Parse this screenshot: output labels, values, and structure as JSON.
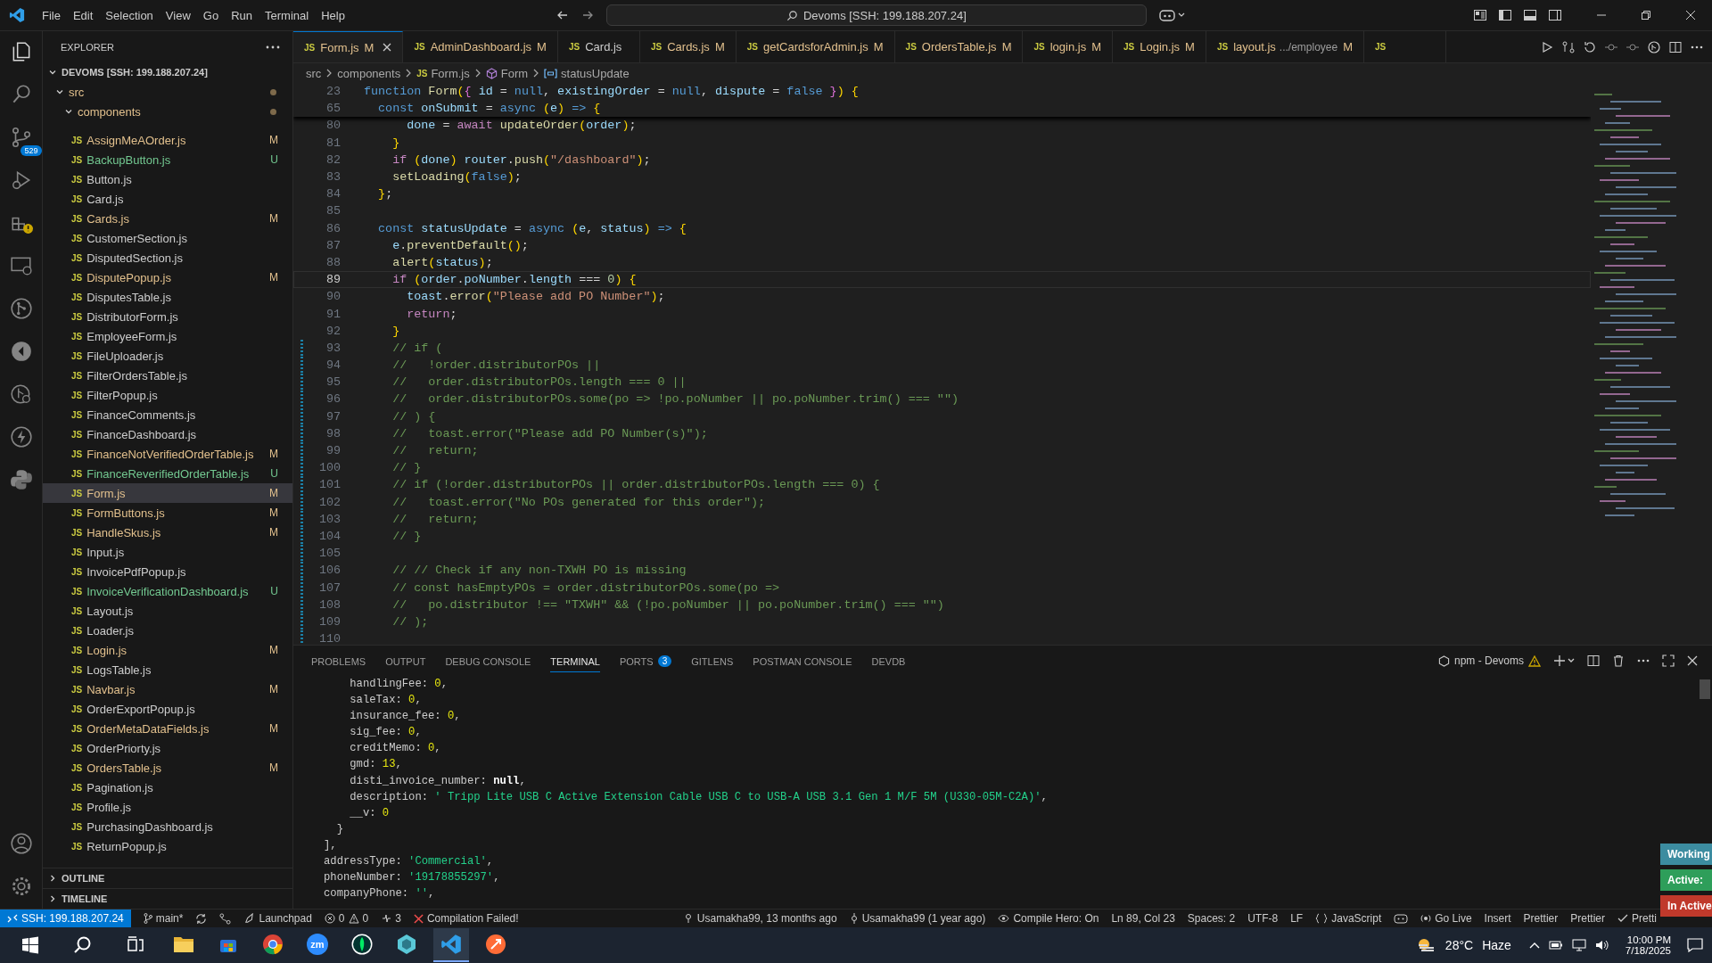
{
  "title_bar": {
    "menu": [
      "File",
      "Edit",
      "Selection",
      "View",
      "Go",
      "Run",
      "Terminal",
      "Help"
    ],
    "command_center": "Devoms [SSH: 199.188.207.24]"
  },
  "activity_bar": {
    "source_control_badge": "529"
  },
  "explorer": {
    "title": "EXPLORER",
    "root": {
      "name": "DEVOMS [SSH: 199.188.207.24]",
      "expanded": true
    },
    "folders": [
      {
        "name": "src",
        "expanded": true,
        "modified": true
      },
      {
        "name": "components",
        "expanded": true,
        "modified": true
      }
    ],
    "files": [
      {
        "icon": "JS",
        "name": "AssignMeAOrder.js",
        "status": "M",
        "selected": false
      },
      {
        "icon": "JS",
        "name": "BackupButton.js",
        "status": "U",
        "selected": false
      },
      {
        "icon": "JS",
        "name": "Button.js",
        "selected": false
      },
      {
        "icon": "JS",
        "name": "Card.js",
        "selected": false
      },
      {
        "icon": "JS",
        "name": "Cards.js",
        "status": "M",
        "selected": false
      },
      {
        "icon": "JS",
        "name": "CustomerSection.js",
        "selected": false
      },
      {
        "icon": "JS",
        "name": "DisputedSection.js",
        "selected": false
      },
      {
        "icon": "JS",
        "name": "DisputePopup.js",
        "status": "M",
        "selected": false
      },
      {
        "icon": "JS",
        "name": "DisputesTable.js",
        "selected": false
      },
      {
        "icon": "JS",
        "name": "DistributorForm.js",
        "selected": false
      },
      {
        "icon": "JS",
        "name": "EmployeeForm.js",
        "selected": false
      },
      {
        "icon": "JS",
        "name": "FileUploader.js",
        "selected": false
      },
      {
        "icon": "JS",
        "name": "FilterOrdersTable.js",
        "selected": false
      },
      {
        "icon": "JS",
        "name": "FilterPopup.js",
        "selected": false
      },
      {
        "icon": "JS",
        "name": "FinanceComments.js",
        "selected": false
      },
      {
        "icon": "JS",
        "name": "FinanceDashboard.js",
        "selected": false
      },
      {
        "icon": "JS",
        "name": "FinanceNotVerifiedOrderTable.js",
        "status": "M",
        "selected": false
      },
      {
        "icon": "JS",
        "name": "FinanceReverifiedOrderTable.js",
        "status": "U",
        "selected": false
      },
      {
        "icon": "JS",
        "name": "Form.js",
        "status": "M",
        "selected": true
      },
      {
        "icon": "JS",
        "name": "FormButtons.js",
        "status": "M",
        "selected": false
      },
      {
        "icon": "JS",
        "name": "HandleSkus.js",
        "status": "M",
        "selected": false
      },
      {
        "icon": "JS",
        "name": "Input.js",
        "selected": false
      },
      {
        "icon": "JS",
        "name": "InvoicePdfPopup.js",
        "selected": false
      },
      {
        "icon": "JS",
        "name": "InvoiceVerificationDashboard.js",
        "status": "U",
        "selected": false
      },
      {
        "icon": "JS",
        "name": "Layout.js",
        "selected": false
      },
      {
        "icon": "JS",
        "name": "Loader.js",
        "selected": false
      },
      {
        "icon": "JS",
        "name": "Login.js",
        "status": "M",
        "selected": false
      },
      {
        "icon": "JS",
        "name": "LogsTable.js",
        "selected": false
      },
      {
        "icon": "JS",
        "name": "Navbar.js",
        "status": "M",
        "selected": false
      },
      {
        "icon": "JS",
        "name": "OrderExportPopup.js",
        "selected": false
      },
      {
        "icon": "JS",
        "name": "OrderMetaDataFields.js",
        "status": "M",
        "selected": false
      },
      {
        "icon": "JS",
        "name": "OrderPriorty.js",
        "selected": false
      },
      {
        "icon": "JS",
        "name": "OrdersTable.js",
        "status": "M",
        "selected": false
      },
      {
        "icon": "JS",
        "name": "Pagination.js",
        "selected": false
      },
      {
        "icon": "JS",
        "name": "Profile.js",
        "selected": false
      },
      {
        "icon": "JS",
        "name": "PurchasingDashboard.js",
        "selected": false
      },
      {
        "icon": "JS",
        "name": "ReturnPopup.js",
        "selected": false
      }
    ],
    "sections": [
      {
        "name": "OUTLINE",
        "expanded": false
      },
      {
        "name": "TIMELINE",
        "expanded": false
      }
    ]
  },
  "tabs": [
    {
      "icon": "JS",
      "label": "Form.js",
      "status": "M",
      "selected": true
    },
    {
      "icon": "JS",
      "label": "AdminDashboard.js",
      "status": "M",
      "selected": false
    },
    {
      "icon": "JS",
      "label": "Card.js",
      "selected": false
    },
    {
      "icon": "JS",
      "label": "Cards.js",
      "status": "M",
      "selected": false
    },
    {
      "icon": "JS",
      "label": "getCardsforAdmin.js",
      "status": "M",
      "selected": false
    },
    {
      "icon": "JS",
      "label": "OrdersTable.js",
      "status": "M",
      "selected": false
    },
    {
      "icon": "JS",
      "label": "login.js",
      "status": "M",
      "selected": false
    },
    {
      "icon": "JS",
      "label": "Login.js",
      "status": "M",
      "selected": false
    },
    {
      "icon": "JS",
      "label": "layout.js",
      "description": ".../employee",
      "status": "M",
      "selected": false
    },
    {
      "icon": "JS",
      "selected": false
    }
  ],
  "breadcrumb": [
    {
      "kind": "folder",
      "label": "src"
    },
    {
      "kind": "folder",
      "label": "components"
    },
    {
      "kind": "file",
      "icon": "JS",
      "label": "Form.js"
    },
    {
      "kind": "function",
      "label": "Form"
    },
    {
      "kind": "variable",
      "label": "statusUpdate"
    }
  ],
  "editor": {
    "sticky_lines": [
      {
        "number": "23",
        "text": "function Form({ id = null, existingOrder = null, dispute = false }) {"
      },
      {
        "number": "65",
        "text": "  const onSubmit = async (e) => {"
      }
    ],
    "lines": [
      {
        "number": "80",
        "cursor": false,
        "changed": false,
        "text": "      done = await updateOrder(order);"
      },
      {
        "number": "81",
        "cursor": false,
        "changed": false,
        "text": "    }"
      },
      {
        "number": "82",
        "cursor": false,
        "changed": false,
        "text": "    if (done) router.push(\"/dashboard\");"
      },
      {
        "number": "83",
        "cursor": false,
        "changed": false,
        "text": "    setLoading(false);"
      },
      {
        "number": "84",
        "cursor": false,
        "changed": false,
        "text": "  };"
      },
      {
        "number": "85",
        "cursor": false,
        "changed": false
      },
      {
        "number": "86",
        "cursor": false,
        "changed": false,
        "text": "  const statusUpdate = async (e, status) => {"
      },
      {
        "number": "87",
        "cursor": false,
        "changed": false,
        "text": "    e.preventDefault();"
      },
      {
        "number": "88",
        "cursor": false,
        "changed": false,
        "text": "    alert(status);"
      },
      {
        "number": "89",
        "cursor": true,
        "changed": false,
        "text": "    if (order.poNumber.length === 0) {"
      },
      {
        "number": "90",
        "cursor": false,
        "changed": false,
        "text": "      toast.error(\"Please add PO Number\");"
      },
      {
        "number": "91",
        "cursor": false,
        "changed": false,
        "text": "      return;"
      },
      {
        "number": "92",
        "cursor": false,
        "changed": false,
        "text": "    }"
      },
      {
        "number": "93",
        "cursor": false,
        "changed": true,
        "text": "    // if ("
      },
      {
        "number": "94",
        "cursor": false,
        "changed": true,
        "text": "    //   !order.distributorPOs ||"
      },
      {
        "number": "95",
        "cursor": false,
        "changed": true,
        "text": "    //   order.distributorPOs.length === 0 ||"
      },
      {
        "number": "96",
        "cursor": false,
        "changed": true,
        "text": "    //   order.distributorPOs.some(po => !po.poNumber || po.poNumber.trim() === \"\")"
      },
      {
        "number": "97",
        "cursor": false,
        "changed": true,
        "text": "    // ) {"
      },
      {
        "number": "98",
        "cursor": false,
        "changed": true,
        "text": "    //   toast.error(\"Please add PO Number(s)\");"
      },
      {
        "number": "99",
        "cursor": false,
        "changed": true,
        "text": "    //   return;"
      },
      {
        "number": "100",
        "cursor": false,
        "changed": true,
        "text": "    // }"
      },
      {
        "number": "101",
        "cursor": false,
        "changed": true,
        "text": "    // if (!order.distributorPOs || order.distributorPOs.length === 0) {"
      },
      {
        "number": "102",
        "cursor": false,
        "changed": true,
        "text": "    //   toast.error(\"No POs generated for this order\");"
      },
      {
        "number": "103",
        "cursor": false,
        "changed": true,
        "text": "    //   return;"
      },
      {
        "number": "104",
        "cursor": false,
        "changed": true,
        "text": "    // }"
      },
      {
        "number": "105",
        "cursor": false,
        "changed": true
      },
      {
        "number": "106",
        "cursor": false,
        "changed": true,
        "text": "    // // Check if any non-TXWH PO is missing"
      },
      {
        "number": "107",
        "cursor": false,
        "changed": true,
        "text": "    // const hasEmptyPOs = order.distributorPOs.some(po =>"
      },
      {
        "number": "108",
        "cursor": false,
        "changed": true,
        "text": "    //   po.distributor !== \"TXWH\" && (!po.poNumber || po.poNumber.trim() === \"\")"
      },
      {
        "number": "109",
        "cursor": false,
        "changed": true,
        "text": "    // );"
      },
      {
        "number": "110",
        "cursor": false,
        "changed": true
      }
    ]
  },
  "panel": {
    "tabs": [
      {
        "label": "PROBLEMS",
        "selected": false
      },
      {
        "label": "OUTPUT",
        "selected": false
      },
      {
        "label": "DEBUG CONSOLE",
        "selected": false
      },
      {
        "label": "TERMINAL",
        "selected": true
      },
      {
        "label": "PORTS",
        "badge": "3",
        "selected": false
      },
      {
        "label": "GITLENS",
        "selected": false
      },
      {
        "label": "POSTMAN CONSOLE",
        "selected": false
      },
      {
        "label": "DEVDB",
        "selected": false
      }
    ],
    "terminal_name": "npm - Devoms",
    "terminal_lines": [
      "    handlingFee: 0,",
      "    saleTax: 0,",
      "    insurance_fee: 0,",
      "    sig_fee: 0,",
      "    creditMemo: 0,",
      "    gmd: 13,",
      "    disti_invoice_number: null,",
      "    description: ' Tripp Lite USB C Active Extension Cable USB C to USB-A USB 3.1 Gen 1 M/F 5M (U330-05M-C2A)',",
      "    __v: 0",
      "  }",
      "],",
      "addressType: 'Commercial',",
      "phoneNumber: '19178855297',",
      "companyPhone: '',"
    ]
  },
  "notifications": [
    {
      "label": "Working",
      "color": "#3c8ca0"
    },
    {
      "label": "Active:",
      "color": "#2e9e5a"
    },
    {
      "label": "In Active",
      "color": "#c0392b"
    }
  ],
  "status_bar": {
    "left": [
      {
        "kind": "remote",
        "text": "SSH: 199.188.207.24"
      },
      {
        "kind": "branch",
        "text": "main*"
      },
      {
        "kind": "sync"
      },
      {
        "kind": "flow"
      },
      {
        "kind": "launchpad",
        "text": "Launchpad"
      },
      {
        "kind": "problems",
        "errors": "0",
        "warnings": "0"
      },
      {
        "kind": "ports",
        "text": "3"
      },
      {
        "kind": "error",
        "text": "Compilation Failed!"
      }
    ],
    "right": [
      {
        "kind": "blame",
        "text": "Usamakha99, 13 months ago"
      },
      {
        "kind": "author",
        "text": "Usamakha99 (1 year ago)"
      },
      {
        "kind": "eye",
        "text": "Compile Hero: On"
      },
      {
        "kind": "text",
        "text": "Ln 89, Col 23"
      },
      {
        "kind": "text",
        "text": "Spaces: 2"
      },
      {
        "kind": "text",
        "text": "UTF-8"
      },
      {
        "kind": "text",
        "text": "LF"
      },
      {
        "kind": "language",
        "text": "JavaScript"
      },
      {
        "kind": "copilot"
      },
      {
        "kind": "golive",
        "text": "Go Live"
      },
      {
        "kind": "text",
        "text": "Insert"
      },
      {
        "kind": "text",
        "text": "Prettier"
      },
      {
        "kind": "text",
        "text": "Prettier"
      },
      {
        "kind": "check",
        "text": "Pretti"
      }
    ]
  },
  "taskbar": {
    "apps": [
      {
        "kind": "files",
        "selected": false
      },
      {
        "kind": "store",
        "selected": false
      },
      {
        "kind": "chrome",
        "selected": false
      },
      {
        "kind": "zoom",
        "label": "zm",
        "selected": false
      },
      {
        "kind": "leaf",
        "selected": false
      },
      {
        "kind": "gem",
        "selected": false
      },
      {
        "kind": "vscode",
        "selected": true
      },
      {
        "kind": "postman",
        "selected": false
      }
    ],
    "temperature": "28°C",
    "weather": "Haze",
    "time": "10:00 PM",
    "date": "7/18/2025"
  }
}
